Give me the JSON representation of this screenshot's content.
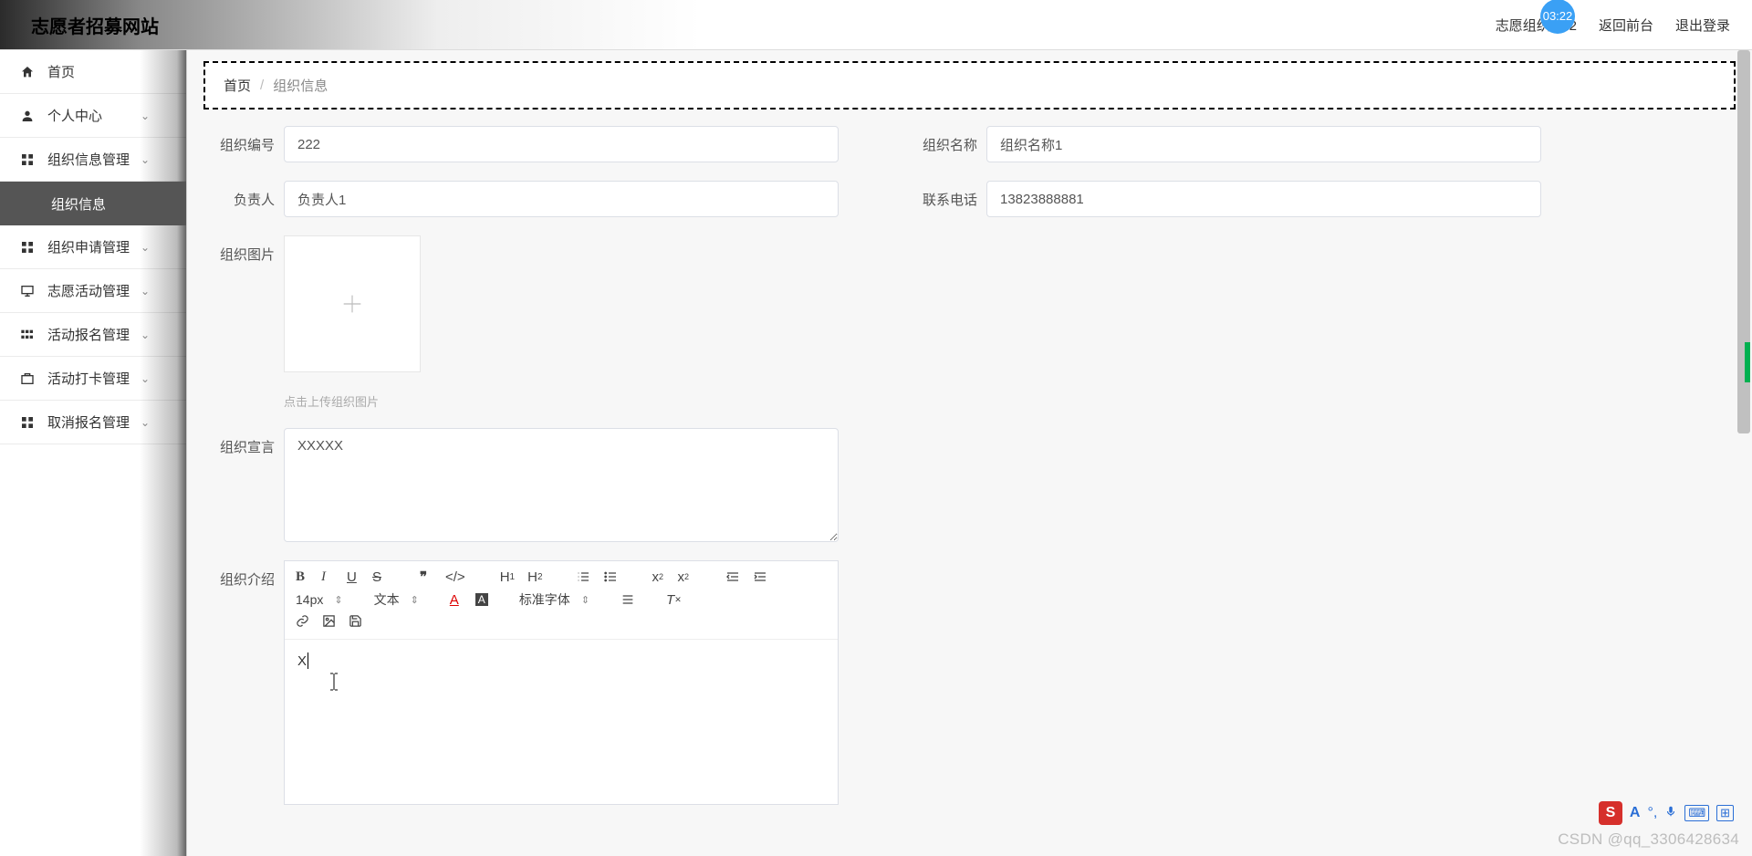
{
  "header": {
    "logo": "志愿者招募网站",
    "org_label": "志愿组织 222",
    "return_front": "返回前台",
    "logout": "退出登录",
    "time_badge": "03:22"
  },
  "sidebar": {
    "items": [
      {
        "icon": "home",
        "label": "首页",
        "expandable": false
      },
      {
        "icon": "person",
        "label": "个人中心",
        "expandable": true
      },
      {
        "icon": "grid",
        "label": "组织信息管理",
        "expandable": true
      },
      {
        "icon": "",
        "label": "组织信息",
        "active": true
      },
      {
        "icon": "grid",
        "label": "组织申请管理",
        "expandable": true
      },
      {
        "icon": "monitor",
        "label": "志愿活动管理",
        "expandable": true
      },
      {
        "icon": "grid4",
        "label": "活动报名管理",
        "expandable": true
      },
      {
        "icon": "briefcase",
        "label": "活动打卡管理",
        "expandable": true
      },
      {
        "icon": "grid",
        "label": "取消报名管理",
        "expandable": true
      }
    ]
  },
  "breadcrumb": {
    "home": "首页",
    "current": "组织信息"
  },
  "form": {
    "org_id_label": "组织编号",
    "org_id_value": "222",
    "org_name_label": "组织名称",
    "org_name_value": "组织名称1",
    "leader_label": "负责人",
    "leader_value": "负责人1",
    "phone_label": "联系电话",
    "phone_value": "13823888881",
    "image_label": "组织图片",
    "upload_hint": "点击上传组织图片",
    "slogan_label": "组织宣言",
    "slogan_value": "XXXXX",
    "intro_label": "组织介绍",
    "intro_content": "X"
  },
  "editor": {
    "font_size": "14px",
    "text_type": "文本",
    "font_family": "标准字体"
  },
  "ime": {
    "letter": "A"
  },
  "watermark": "CSDN @qq_3306428634"
}
